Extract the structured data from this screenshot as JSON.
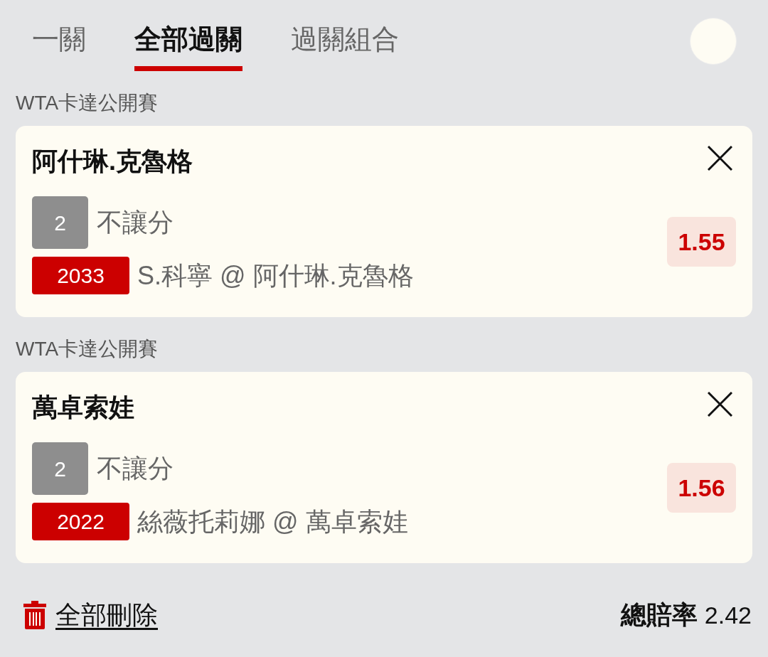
{
  "tabs": [
    {
      "label": "一關",
      "selected": false
    },
    {
      "label": "全部過關",
      "selected": true
    },
    {
      "label": "過關組合",
      "selected": false
    }
  ],
  "bets": [
    {
      "competition": "WTA卡達公開賽",
      "selection": "阿什琳.克魯格",
      "pick": "2",
      "market": "不讓分",
      "match_number": "2033",
      "match": "S.科寧 @ 阿什琳.克魯格",
      "odds": "1.55"
    },
    {
      "competition": "WTA卡達公開賽",
      "selection": "萬卓索娃",
      "pick": "2",
      "market": "不讓分",
      "match_number": "2022",
      "match": "絲薇托莉娜 @ 萬卓索娃",
      "odds": "1.56"
    }
  ],
  "footer": {
    "delete_all": "全部刪除",
    "total_odds_label": "總賠率",
    "total_odds": "2.42"
  }
}
